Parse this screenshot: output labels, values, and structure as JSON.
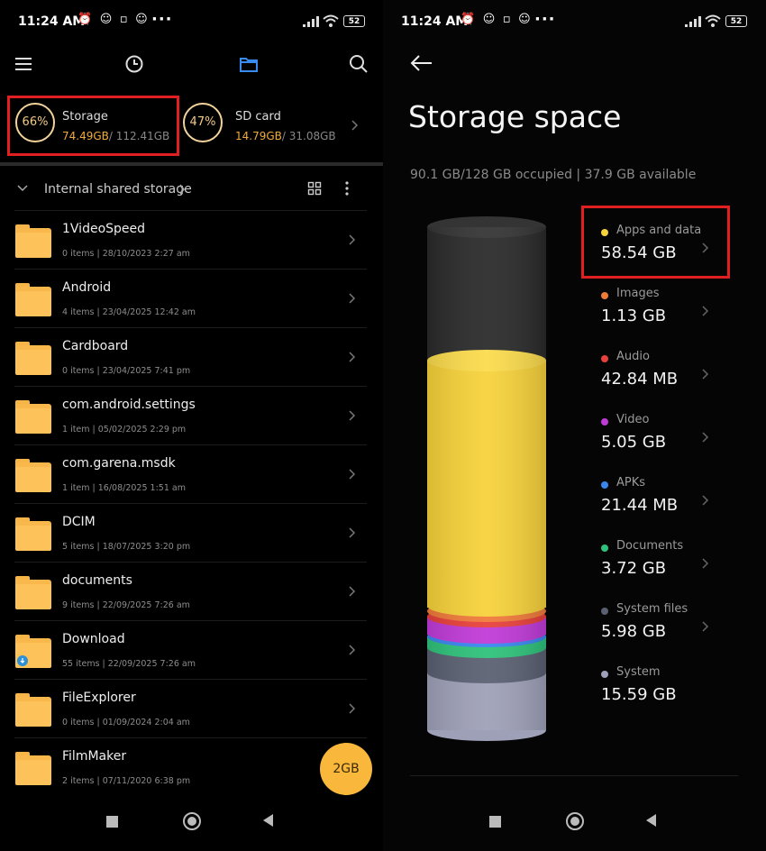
{
  "left": {
    "status": {
      "time": "11:24 AM",
      "battery": "52"
    },
    "storage_cards": [
      {
        "percent": "66%",
        "title": "Storage",
        "used": "74.49GB",
        "total": "/ 112.41GB"
      },
      {
        "percent": "47%",
        "title": "SD card",
        "used": "14.79GB",
        "total": "/ 31.08GB"
      }
    ],
    "breadcrumb": "Internal shared storage",
    "folders": [
      {
        "name": "1VideoSpeed",
        "meta": "0 items  |  28/10/2023 2:27 am"
      },
      {
        "name": "Android",
        "meta": "4 items  |  23/04/2025 12:42 am"
      },
      {
        "name": "Cardboard",
        "meta": "0 items  |  23/04/2025 7:41 pm"
      },
      {
        "name": "com.android.settings",
        "meta": "1 item  |  05/02/2025 2:29 pm"
      },
      {
        "name": "com.garena.msdk",
        "meta": "1 item  |  16/08/2025 1:51 am"
      },
      {
        "name": "DCIM",
        "meta": "5 items  |  18/07/2025 3:20 pm"
      },
      {
        "name": "documents",
        "meta": "9 items  |  22/09/2025 7:26 am"
      },
      {
        "name": "Download",
        "meta": "55 items  |  22/09/2025 7:26 am"
      },
      {
        "name": "FileExplorer",
        "meta": "0 items  |  01/09/2024 2:04 am"
      },
      {
        "name": "FilmMaker",
        "meta": "2 items  |  07/11/2020 6:38 pm"
      }
    ],
    "fab_label": "2GB"
  },
  "right": {
    "status": {
      "time": "11:24 AM",
      "battery": "52"
    },
    "title": "Storage space",
    "summary": "90.1 GB/128 GB occupied | 37.9 GB available",
    "categories": [
      {
        "name": "Apps and data",
        "value": "58.54 GB",
        "color": "#f7d23a"
      },
      {
        "name": "Images",
        "value": "1.13 GB",
        "color": "#f07a3a"
      },
      {
        "name": "Audio",
        "value": "42.84 MB",
        "color": "#e8403a"
      },
      {
        "name": "Video",
        "value": "5.05 GB",
        "color": "#c03ad8"
      },
      {
        "name": "APKs",
        "value": "21.44 MB",
        "color": "#3a86f0"
      },
      {
        "name": "Documents",
        "value": "3.72 GB",
        "color": "#2ec27a"
      },
      {
        "name": "System files",
        "value": "5.98 GB",
        "color": "#5a6072"
      },
      {
        "name": "System",
        "value": "15.59 GB",
        "color": "#9ea0b8"
      }
    ]
  }
}
